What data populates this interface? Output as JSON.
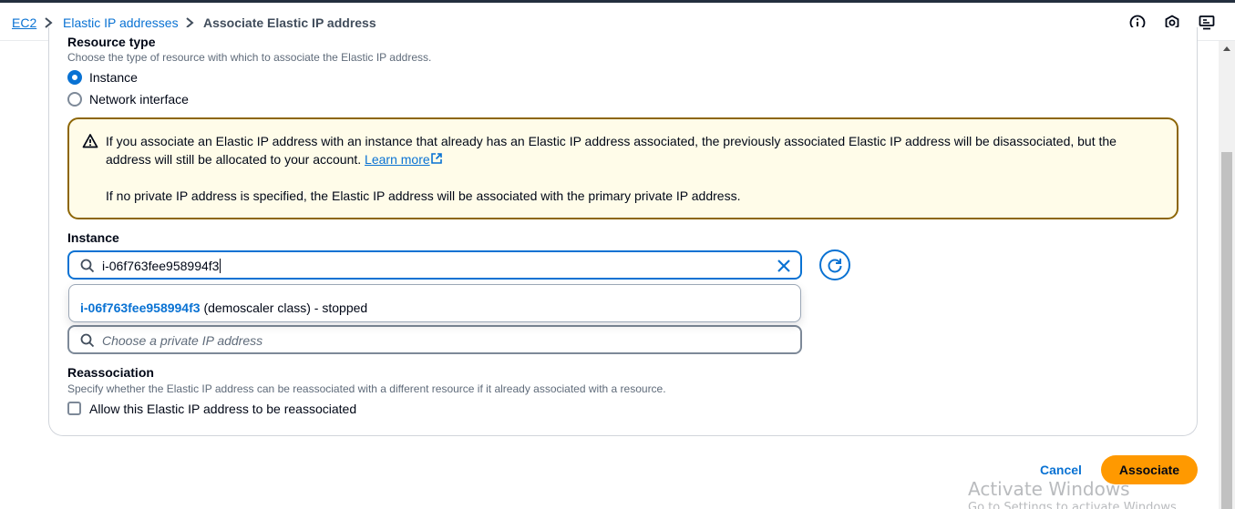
{
  "breadcrumb": {
    "items": [
      "EC2",
      "Elastic IP addresses"
    ],
    "current": "Associate Elastic IP address"
  },
  "top_icons": [
    "info-icon",
    "settings-hex-icon",
    "feedback-icon"
  ],
  "resource_type": {
    "label": "Resource type",
    "description": "Choose the type of resource with which to associate the Elastic IP address.",
    "options": [
      {
        "label": "Instance",
        "selected": true
      },
      {
        "label": "Network interface",
        "selected": false
      }
    ]
  },
  "alert": {
    "line1": "If you associate an Elastic IP address with an instance that already has an Elastic IP address associated, the previously associated Elastic IP address will be disassociated, but the",
    "line2": "address will still be allocated to your account.",
    "link": "Learn more",
    "line3": "If no private IP address is specified, the Elastic IP address will be associated with the primary private IP address."
  },
  "instance": {
    "label": "Instance",
    "value": "i-06f763fee958994f3",
    "dropdown": {
      "id": "i-06f763fee958994f3",
      "detail": "(demoscaler class) - stopped"
    }
  },
  "private_ip": {
    "placeholder": "Choose a private IP address"
  },
  "reassociation": {
    "label": "Reassociation",
    "description": "Specify whether the Elastic IP address can be reassociated with a different resource if it already associated with a resource.",
    "checkbox_label": "Allow this Elastic IP address to be reassociated",
    "checked": false
  },
  "actions": {
    "cancel": "Cancel",
    "associate": "Associate"
  },
  "watermark": {
    "title": "Activate Windows",
    "subtitle": "Go to Settings to activate Windows."
  },
  "colors": {
    "link": "#0972d3",
    "primary_button": "#ff9900",
    "alert_bg": "#fffce9",
    "alert_border": "#8d6605"
  }
}
